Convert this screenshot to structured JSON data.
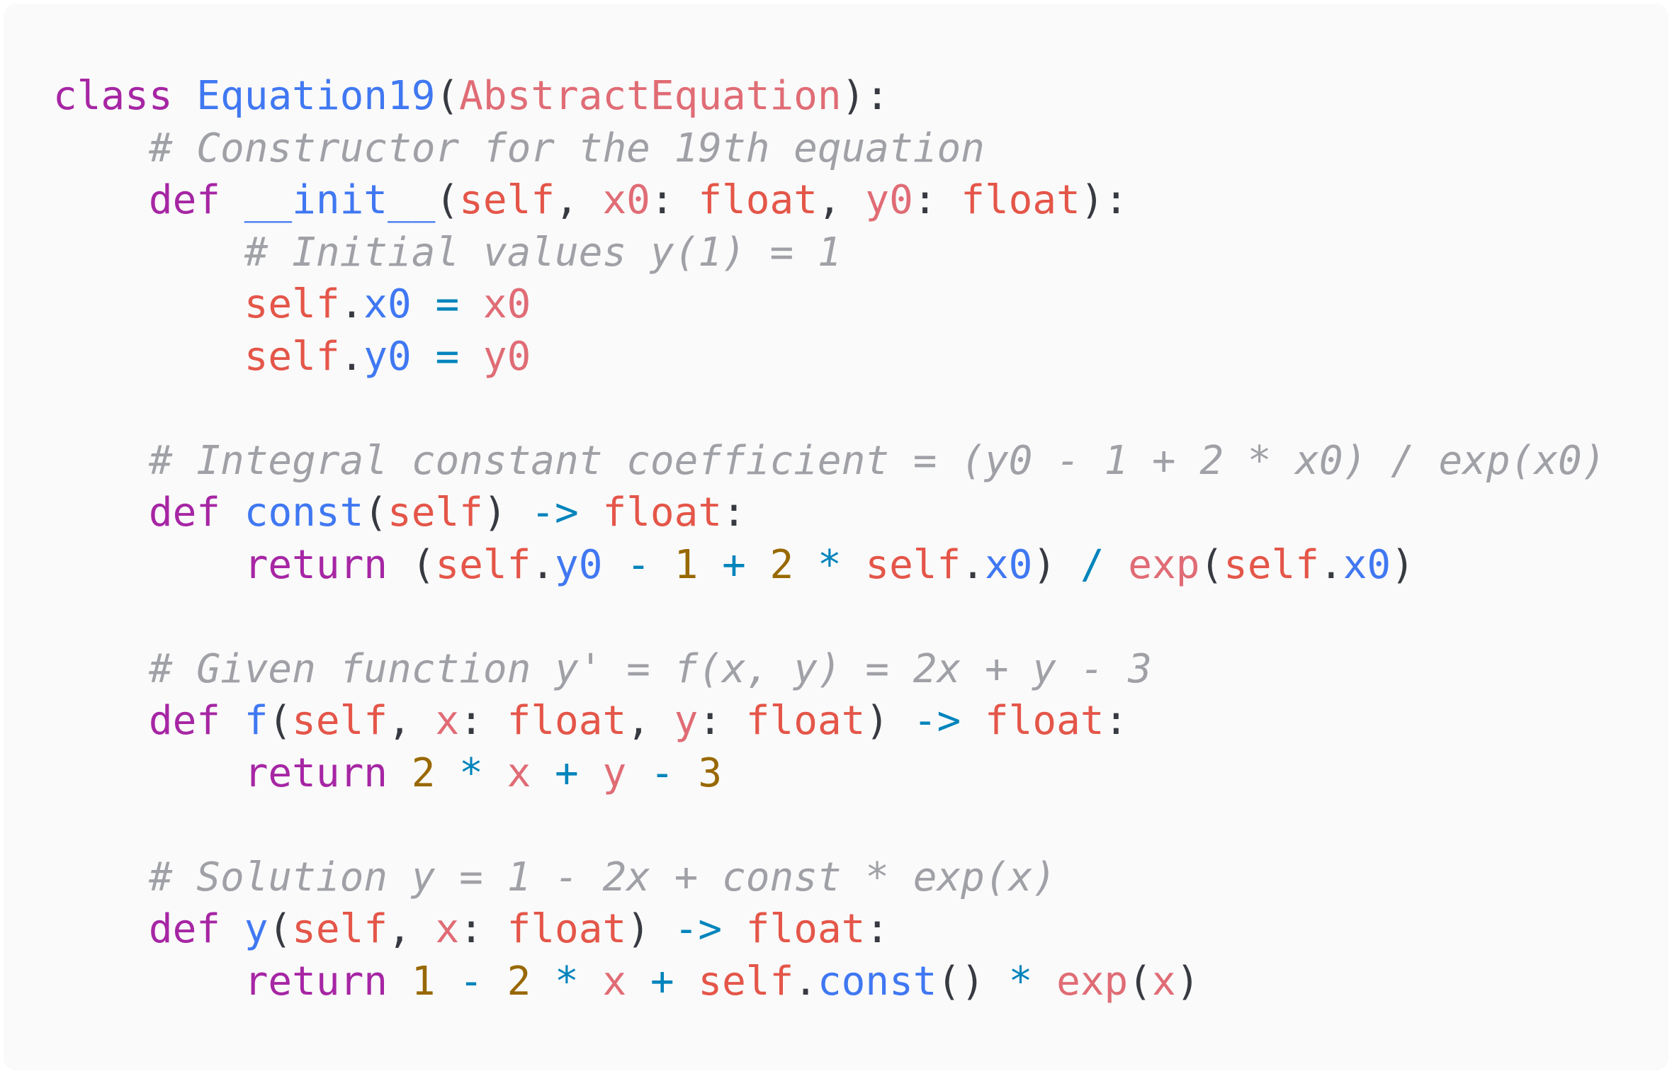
{
  "colors": {
    "background": "#fafafa",
    "keyword": "#a626a4",
    "function_name": "#4078f2",
    "class_base": "#e06c75",
    "parameter": "#e06c75",
    "self": "#e45649",
    "type": "#e45649",
    "operator": "#0184bc",
    "number": "#986801",
    "comment": "#a0a1a7",
    "punctuation": "#383a42"
  },
  "code": {
    "language": "python",
    "lines": [
      [
        {
          "text": "class",
          "type": "kw"
        },
        {
          "text": " ",
          "type": "plain"
        },
        {
          "text": "Equation19",
          "type": "fn"
        },
        {
          "text": "(",
          "type": "punc"
        },
        {
          "text": "AbstractEquation",
          "type": "base"
        },
        {
          "text": "):",
          "type": "punc"
        }
      ],
      [
        {
          "text": "    ",
          "type": "plain"
        },
        {
          "text": "# Constructor for the 19th equation",
          "type": "comment"
        }
      ],
      [
        {
          "text": "    ",
          "type": "plain"
        },
        {
          "text": "def",
          "type": "kw"
        },
        {
          "text": " ",
          "type": "plain"
        },
        {
          "text": "__init__",
          "type": "fn"
        },
        {
          "text": "(",
          "type": "punc"
        },
        {
          "text": "self",
          "type": "self"
        },
        {
          "text": ", ",
          "type": "punc"
        },
        {
          "text": "x0",
          "type": "param"
        },
        {
          "text": ": ",
          "type": "punc"
        },
        {
          "text": "float",
          "type": "type"
        },
        {
          "text": ", ",
          "type": "punc"
        },
        {
          "text": "y0",
          "type": "param"
        },
        {
          "text": ": ",
          "type": "punc"
        },
        {
          "text": "float",
          "type": "type"
        },
        {
          "text": "):",
          "type": "punc"
        }
      ],
      [
        {
          "text": "        ",
          "type": "plain"
        },
        {
          "text": "# Initial values y(1) = 1",
          "type": "comment"
        }
      ],
      [
        {
          "text": "        ",
          "type": "plain"
        },
        {
          "text": "self",
          "type": "self"
        },
        {
          "text": ".",
          "type": "punc"
        },
        {
          "text": "x0",
          "type": "attr"
        },
        {
          "text": " ",
          "type": "plain"
        },
        {
          "text": "=",
          "type": "op"
        },
        {
          "text": " ",
          "type": "plain"
        },
        {
          "text": "x0",
          "type": "param"
        }
      ],
      [
        {
          "text": "        ",
          "type": "plain"
        },
        {
          "text": "self",
          "type": "self"
        },
        {
          "text": ".",
          "type": "punc"
        },
        {
          "text": "y0",
          "type": "attr"
        },
        {
          "text": " ",
          "type": "plain"
        },
        {
          "text": "=",
          "type": "op"
        },
        {
          "text": " ",
          "type": "plain"
        },
        {
          "text": "y0",
          "type": "param"
        }
      ],
      [],
      [
        {
          "text": "    ",
          "type": "plain"
        },
        {
          "text": "# Integral constant coefficient = (y0 - 1 + 2 * x0) / exp(x0)",
          "type": "comment"
        }
      ],
      [
        {
          "text": "    ",
          "type": "plain"
        },
        {
          "text": "def",
          "type": "kw"
        },
        {
          "text": " ",
          "type": "plain"
        },
        {
          "text": "const",
          "type": "fn"
        },
        {
          "text": "(",
          "type": "punc"
        },
        {
          "text": "self",
          "type": "self"
        },
        {
          "text": ")",
          "type": "punc"
        },
        {
          "text": " ",
          "type": "plain"
        },
        {
          "text": "->",
          "type": "op"
        },
        {
          "text": " ",
          "type": "plain"
        },
        {
          "text": "float",
          "type": "type"
        },
        {
          "text": ":",
          "type": "punc"
        }
      ],
      [
        {
          "text": "        ",
          "type": "plain"
        },
        {
          "text": "return",
          "type": "kw"
        },
        {
          "text": " (",
          "type": "punc"
        },
        {
          "text": "self",
          "type": "self"
        },
        {
          "text": ".",
          "type": "punc"
        },
        {
          "text": "y0",
          "type": "attr"
        },
        {
          "text": " ",
          "type": "plain"
        },
        {
          "text": "-",
          "type": "op"
        },
        {
          "text": " ",
          "type": "plain"
        },
        {
          "text": "1",
          "type": "num"
        },
        {
          "text": " ",
          "type": "plain"
        },
        {
          "text": "+",
          "type": "op"
        },
        {
          "text": " ",
          "type": "plain"
        },
        {
          "text": "2",
          "type": "num"
        },
        {
          "text": " ",
          "type": "plain"
        },
        {
          "text": "*",
          "type": "op"
        },
        {
          "text": " ",
          "type": "plain"
        },
        {
          "text": "self",
          "type": "self"
        },
        {
          "text": ".",
          "type": "punc"
        },
        {
          "text": "x0",
          "type": "attr"
        },
        {
          "text": ")",
          "type": "punc"
        },
        {
          "text": " ",
          "type": "plain"
        },
        {
          "text": "/",
          "type": "op"
        },
        {
          "text": " ",
          "type": "plain"
        },
        {
          "text": "exp",
          "type": "call"
        },
        {
          "text": "(",
          "type": "punc"
        },
        {
          "text": "self",
          "type": "self"
        },
        {
          "text": ".",
          "type": "punc"
        },
        {
          "text": "x0",
          "type": "attr"
        },
        {
          "text": ")",
          "type": "punc"
        }
      ],
      [],
      [
        {
          "text": "    ",
          "type": "plain"
        },
        {
          "text": "# Given function y' = f(x, y) = 2x + y - 3",
          "type": "comment"
        }
      ],
      [
        {
          "text": "    ",
          "type": "plain"
        },
        {
          "text": "def",
          "type": "kw"
        },
        {
          "text": " ",
          "type": "plain"
        },
        {
          "text": "f",
          "type": "fn"
        },
        {
          "text": "(",
          "type": "punc"
        },
        {
          "text": "self",
          "type": "self"
        },
        {
          "text": ", ",
          "type": "punc"
        },
        {
          "text": "x",
          "type": "param"
        },
        {
          "text": ": ",
          "type": "punc"
        },
        {
          "text": "float",
          "type": "type"
        },
        {
          "text": ", ",
          "type": "punc"
        },
        {
          "text": "y",
          "type": "param"
        },
        {
          "text": ": ",
          "type": "punc"
        },
        {
          "text": "float",
          "type": "type"
        },
        {
          "text": ")",
          "type": "punc"
        },
        {
          "text": " ",
          "type": "plain"
        },
        {
          "text": "->",
          "type": "op"
        },
        {
          "text": " ",
          "type": "plain"
        },
        {
          "text": "float",
          "type": "type"
        },
        {
          "text": ":",
          "type": "punc"
        }
      ],
      [
        {
          "text": "        ",
          "type": "plain"
        },
        {
          "text": "return",
          "type": "kw"
        },
        {
          "text": " ",
          "type": "plain"
        },
        {
          "text": "2",
          "type": "num"
        },
        {
          "text": " ",
          "type": "plain"
        },
        {
          "text": "*",
          "type": "op"
        },
        {
          "text": " ",
          "type": "plain"
        },
        {
          "text": "x",
          "type": "param"
        },
        {
          "text": " ",
          "type": "plain"
        },
        {
          "text": "+",
          "type": "op"
        },
        {
          "text": " ",
          "type": "plain"
        },
        {
          "text": "y",
          "type": "param"
        },
        {
          "text": " ",
          "type": "plain"
        },
        {
          "text": "-",
          "type": "op"
        },
        {
          "text": " ",
          "type": "plain"
        },
        {
          "text": "3",
          "type": "num"
        }
      ],
      [],
      [
        {
          "text": "    ",
          "type": "plain"
        },
        {
          "text": "# Solution y = 1 - 2x + const * exp(x)",
          "type": "comment"
        }
      ],
      [
        {
          "text": "    ",
          "type": "plain"
        },
        {
          "text": "def",
          "type": "kw"
        },
        {
          "text": " ",
          "type": "plain"
        },
        {
          "text": "y",
          "type": "fn"
        },
        {
          "text": "(",
          "type": "punc"
        },
        {
          "text": "self",
          "type": "self"
        },
        {
          "text": ", ",
          "type": "punc"
        },
        {
          "text": "x",
          "type": "param"
        },
        {
          "text": ": ",
          "type": "punc"
        },
        {
          "text": "float",
          "type": "type"
        },
        {
          "text": ")",
          "type": "punc"
        },
        {
          "text": " ",
          "type": "plain"
        },
        {
          "text": "->",
          "type": "op"
        },
        {
          "text": " ",
          "type": "plain"
        },
        {
          "text": "float",
          "type": "type"
        },
        {
          "text": ":",
          "type": "punc"
        }
      ],
      [
        {
          "text": "        ",
          "type": "plain"
        },
        {
          "text": "return",
          "type": "kw"
        },
        {
          "text": " ",
          "type": "plain"
        },
        {
          "text": "1",
          "type": "num"
        },
        {
          "text": " ",
          "type": "plain"
        },
        {
          "text": "-",
          "type": "op"
        },
        {
          "text": " ",
          "type": "plain"
        },
        {
          "text": "2",
          "type": "num"
        },
        {
          "text": " ",
          "type": "plain"
        },
        {
          "text": "*",
          "type": "op"
        },
        {
          "text": " ",
          "type": "plain"
        },
        {
          "text": "x",
          "type": "param"
        },
        {
          "text": " ",
          "type": "plain"
        },
        {
          "text": "+",
          "type": "op"
        },
        {
          "text": " ",
          "type": "plain"
        },
        {
          "text": "self",
          "type": "self"
        },
        {
          "text": ".",
          "type": "punc"
        },
        {
          "text": "const",
          "type": "attr"
        },
        {
          "text": "()",
          "type": "punc"
        },
        {
          "text": " ",
          "type": "plain"
        },
        {
          "text": "*",
          "type": "op"
        },
        {
          "text": " ",
          "type": "plain"
        },
        {
          "text": "exp",
          "type": "call"
        },
        {
          "text": "(",
          "type": "punc"
        },
        {
          "text": "x",
          "type": "param"
        },
        {
          "text": ")",
          "type": "punc"
        }
      ]
    ]
  }
}
